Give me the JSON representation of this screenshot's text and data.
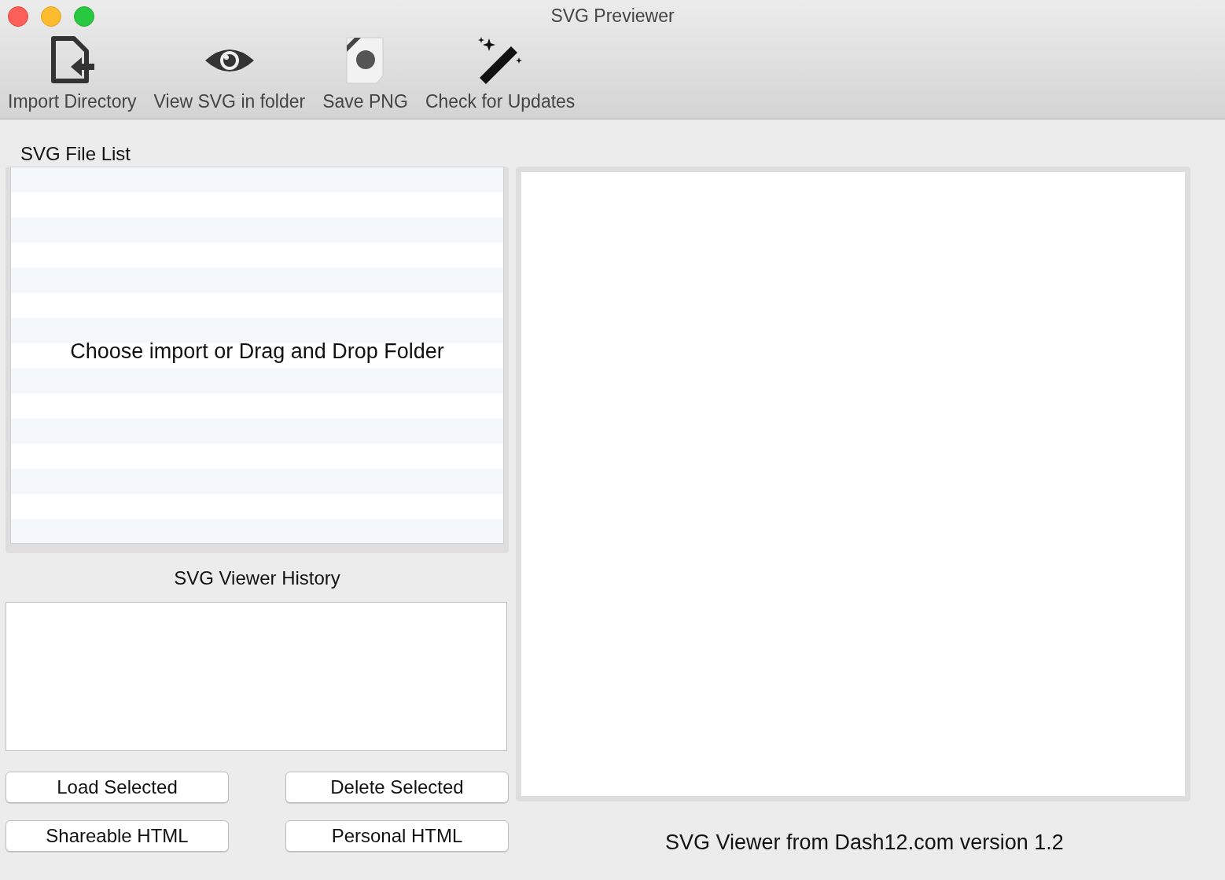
{
  "window": {
    "title": "SVG Previewer"
  },
  "toolbar": [
    {
      "kind": "import",
      "label": "Import Directory"
    },
    {
      "kind": "eye",
      "label": "View SVG in folder"
    },
    {
      "kind": "save",
      "label": "Save PNG"
    },
    {
      "kind": "wand",
      "label": "Check for Updates"
    }
  ],
  "file_list": {
    "title": "SVG File List",
    "placeholder": "Choose import or Drag and Drop Folder"
  },
  "history": {
    "title": "SVG Viewer History"
  },
  "buttons": [
    {
      "label": "Load Selected"
    },
    {
      "label": "Delete Selected"
    },
    {
      "label": "Shareable HTML"
    },
    {
      "label": "Personal HTML"
    }
  ],
  "footer": "SVG Viewer from Dash12.com version 1.2"
}
